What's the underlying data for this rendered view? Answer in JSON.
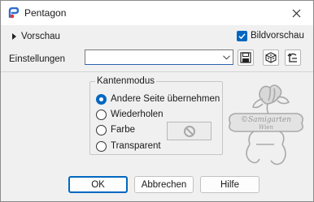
{
  "window": {
    "title": "Pentagon",
    "close_icon": "close-icon"
  },
  "preview": {
    "toggle_label": "Vorschau",
    "bildvorschau_label": "Bildvorschau",
    "bildvorschau_checked": true
  },
  "settings": {
    "label": "Einstellungen",
    "preset_value": "",
    "tools": [
      "save-icon",
      "randomize-icon",
      "reset-icon"
    ]
  },
  "kantenmodus": {
    "title": "Kantenmodus",
    "options": [
      {
        "label": "Andere Seite übernehmen",
        "selected": true
      },
      {
        "label": "Wiederholen",
        "selected": false
      },
      {
        "label": "Farbe",
        "selected": false
      },
      {
        "label": "Transparent",
        "selected": false
      }
    ],
    "color_swatch_icon": "no-symbol-icon"
  },
  "watermark": {
    "line1": "©Samigarten",
    "line2": "Wien"
  },
  "buttons": {
    "ok": "OK",
    "cancel": "Abbrechen",
    "help": "Hilfe"
  },
  "colors": {
    "accent": "#0067c0",
    "dialog_bg": "#f0f0f0"
  }
}
